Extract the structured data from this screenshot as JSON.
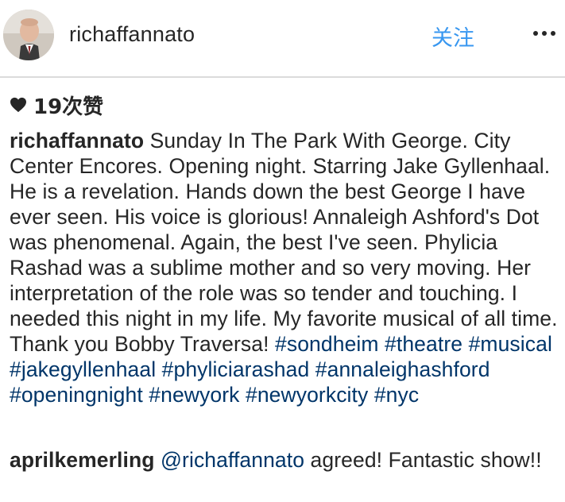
{
  "post": {
    "username": "richaffannato",
    "follow_label": "关注",
    "more_icon": "more-horizontal-icon",
    "likes": {
      "icon": "heart-icon",
      "text": "19次赞"
    },
    "caption": {
      "author": "richaffannato",
      "text": "Sunday In The Park With George. City Center Encores. Opening night. Starring Jake Gyllenhaal. He is a revelation. Hands down the best George I have ever seen. His voice is glorious! Annaleigh Ashford's Dot was phenomenal. Again, the best I've seen. Phylicia Rashad was a sublime mother and so very moving. Her interpretation of the role was so tender and touching. I needed this night in my life. My favorite musical of all time. Thank you Bobby Traversa!",
      "hashtags": [
        "#sondheim",
        "#theatre",
        "#musical",
        "#jakegyllenhaal",
        "#phyliciarashad",
        "#annaleighashford",
        "#openingnight",
        "#newyork",
        "#newyorkcity",
        "#nyc"
      ]
    },
    "comment": {
      "author": "aprilkemerling",
      "mention": "@richaffannato",
      "text": "agreed! Fantastic show!!"
    },
    "colors": {
      "link_blue": "#3897f0",
      "hashtag_blue": "#003569",
      "text": "#262626",
      "divider": "#dbdbdb"
    }
  }
}
